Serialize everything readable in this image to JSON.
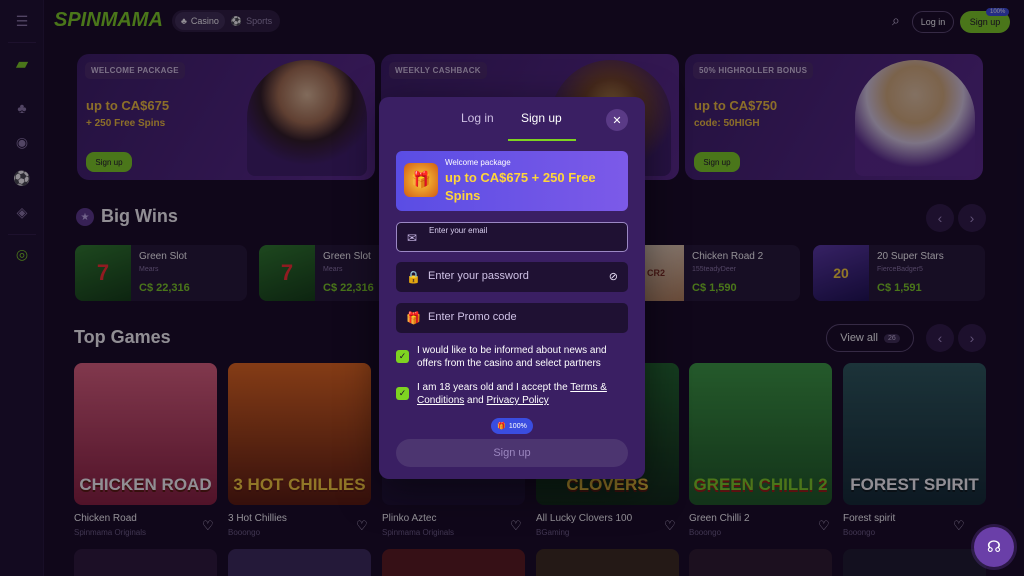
{
  "header": {
    "logo_a": "SPIN",
    "logo_b": "MAMA",
    "seg": [
      {
        "label": "Casino",
        "active": true
      },
      {
        "label": "Sports",
        "active": false
      }
    ],
    "login_label": "Log in",
    "signup_label": "Sign up",
    "signup_badge": "100%"
  },
  "promos": [
    {
      "tag": "WELCOME PACKAGE",
      "headline": "up to CA$675",
      "sub": "+ 250 Free Spins",
      "button": "Sign up"
    },
    {
      "tag": "WEEKLY CASHBACK",
      "headline": "",
      "sub": "",
      "button": ""
    },
    {
      "tag": "50% HIGHROLLER BONUS",
      "headline": "up to CA$750",
      "sub": "code: 50HIGH",
      "button": "Sign up"
    }
  ],
  "big_wins": {
    "title": "Big Wins",
    "cards": [
      {
        "game": "Green Slot",
        "user": "Mears",
        "amount": "C$ 22,316"
      },
      {
        "game": "Green Slot",
        "user": "Mears",
        "amount": "C$ 22,316"
      },
      {
        "game": "Chicken Road 2",
        "user": "155teadyDeer",
        "amount": "C$ 1,590"
      },
      {
        "game": "20 Super Stars",
        "user": "FierceBadger5",
        "amount": "C$ 1,591"
      }
    ]
  },
  "top_games": {
    "title": "Top Games",
    "view_all_label": "View all",
    "view_all_count": "26",
    "games": [
      {
        "art_text": "CHICKEN ROAD",
        "name": "Chicken Road",
        "provider": "Spinmama Originals",
        "color1": "#e2637e",
        "color2": "#8a1f3c"
      },
      {
        "art_text": "3 HOT CHILLIES",
        "name": "3 Hot Chillies",
        "provider": "Booongo",
        "color1": "#e86a1a",
        "color2": "#5a1a08"
      },
      {
        "art_text": "",
        "name": "Plinko Aztec",
        "provider": "Spinmama Originals",
        "color1": "#2a2040",
        "color2": "#1a1030"
      },
      {
        "art_text": "CLOVERS",
        "name": "All Lucky Clovers 100",
        "provider": "BGaming",
        "color1": "#1e6a2a",
        "color2": "#0c2a12"
      },
      {
        "art_text": "GREEN CHILLI 2",
        "name": "Green Chilli 2",
        "provider": "Booongo",
        "color1": "#3aa040",
        "color2": "#1a5a20"
      },
      {
        "art_text": "FOREST SPIRIT",
        "name": "Forest spirit",
        "provider": "Booongo",
        "color1": "#2a5a5a",
        "color2": "#0f2a30"
      }
    ]
  },
  "modal": {
    "tab_login": "Log in",
    "tab_signup": "Sign up",
    "welcome_label": "Welcome package",
    "welcome_value": "up to CA$675 + 250 Free Spins",
    "email_placeholder": "Enter your email",
    "password_placeholder": "Enter your password",
    "promo_placeholder": "Enter Promo code",
    "news_text": "I would like to be informed about news and offers from the casino and select partners",
    "age_text_a": "I am 18 years old and I accept the ",
    "terms_link": "Terms & Conditions",
    "age_text_b": " and ",
    "privacy_link": "Privacy Policy",
    "bonus_badge": "100%",
    "submit_label": "Sign up"
  }
}
